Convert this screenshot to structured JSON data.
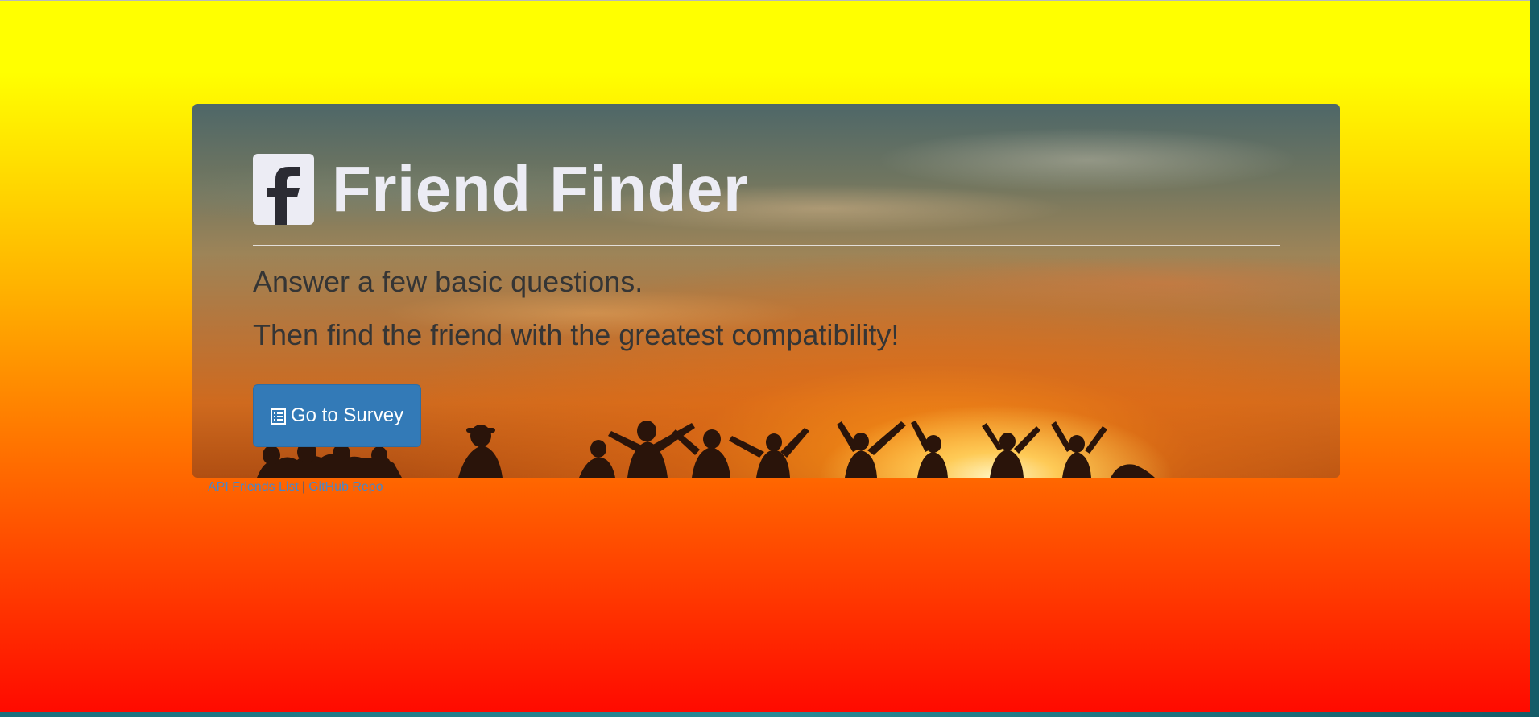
{
  "hero": {
    "icon": "facebook-square-icon",
    "title": "Friend Finder",
    "lead_1": "Answer a few basic questions.",
    "lead_2": "Then find the friend with the greatest compatibility!",
    "button": {
      "icon": "list-alt-icon",
      "label": "Go to Survey"
    }
  },
  "footer": {
    "link_1": "API Friends List",
    "separator": "|",
    "link_2": "GitHub Repo"
  },
  "colors": {
    "gradient_top": "#ffff00",
    "gradient_bottom": "#ff0a00",
    "button": "#337ab7",
    "link": "#4a86c6",
    "title_text": "#ececf4"
  }
}
